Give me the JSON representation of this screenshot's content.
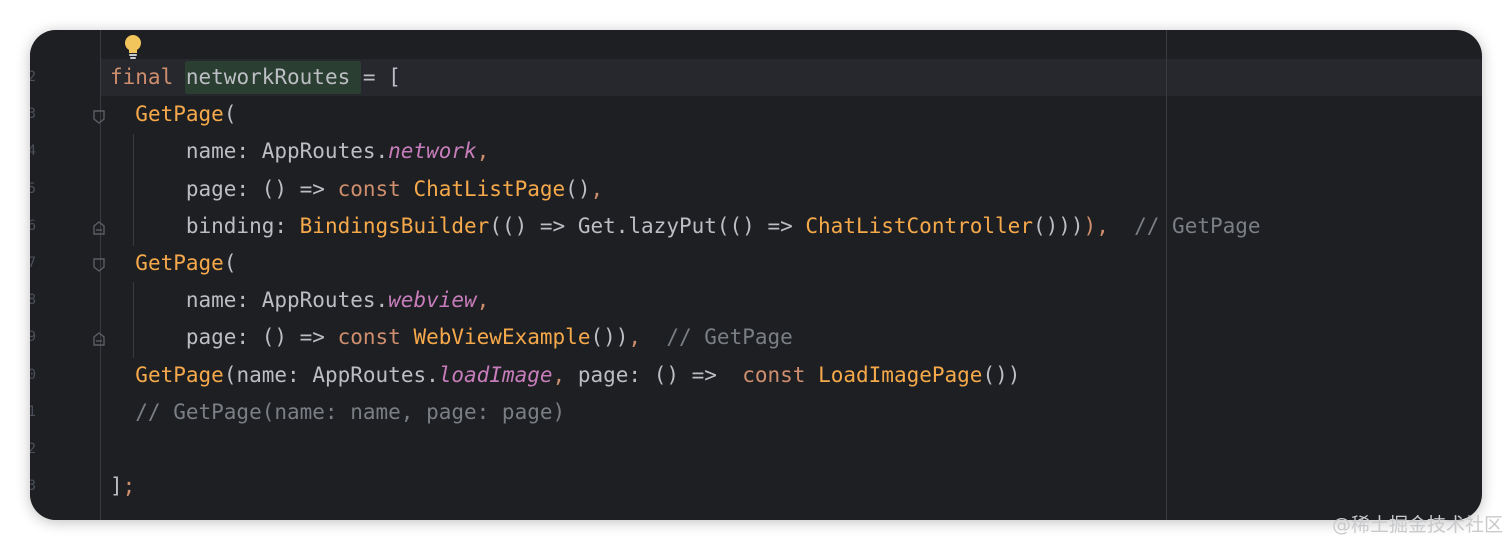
{
  "editor": {
    "line_numbers": [
      "2",
      "3",
      "4",
      "5",
      "6",
      "7",
      "8",
      "9",
      "0",
      "1",
      "2",
      "3"
    ],
    "colors": {
      "background": "#1e1f22",
      "keyword": "#cf8e6d",
      "function": "#f5a94b",
      "field": "#c77dbb",
      "comment": "#7a7e85",
      "plain": "#bcbec4"
    },
    "lines": [
      [
        {
          "t": "final",
          "c": "kw"
        },
        {
          "t": " ",
          "c": "pl"
        },
        {
          "t": "networkRoutes",
          "c": "pl"
        },
        {
          "t": " = [",
          "c": "pl"
        }
      ],
      [
        {
          "t": "  ",
          "c": "pl"
        },
        {
          "t": "GetPage",
          "c": "fn"
        },
        {
          "t": "(",
          "c": "pl"
        }
      ],
      [
        {
          "t": "      name: AppRoutes.",
          "c": "pl"
        },
        {
          "t": "network",
          "c": "fld"
        },
        {
          "t": ",",
          "c": "kw"
        }
      ],
      [
        {
          "t": "      page: () => ",
          "c": "pl"
        },
        {
          "t": "const",
          "c": "kw"
        },
        {
          "t": " ",
          "c": "pl"
        },
        {
          "t": "ChatListPage",
          "c": "fn"
        },
        {
          "t": "()",
          "c": "pl"
        },
        {
          "t": ",",
          "c": "kw"
        }
      ],
      [
        {
          "t": "      binding: ",
          "c": "pl"
        },
        {
          "t": "BindingsBuilder",
          "c": "fn"
        },
        {
          "t": "(() => Get.lazyPut(() => ",
          "c": "pl"
        },
        {
          "t": "ChatListController",
          "c": "fn"
        },
        {
          "t": "()))",
          "c": "pl"
        },
        {
          "t": "),",
          "c": "kw"
        },
        {
          "t": "  // GetPage",
          "c": "cm"
        }
      ],
      [
        {
          "t": "  ",
          "c": "pl"
        },
        {
          "t": "GetPage",
          "c": "fn"
        },
        {
          "t": "(",
          "c": "pl"
        }
      ],
      [
        {
          "t": "      name: AppRoutes.",
          "c": "pl"
        },
        {
          "t": "webview",
          "c": "fld"
        },
        {
          "t": ",",
          "c": "kw"
        }
      ],
      [
        {
          "t": "      page: () => ",
          "c": "pl"
        },
        {
          "t": "const",
          "c": "kw"
        },
        {
          "t": " ",
          "c": "pl"
        },
        {
          "t": "WebViewExample",
          "c": "fn"
        },
        {
          "t": "())",
          "c": "pl"
        },
        {
          "t": ",",
          "c": "kw"
        },
        {
          "t": "  // GetPage",
          "c": "cm"
        }
      ],
      [
        {
          "t": "  ",
          "c": "pl"
        },
        {
          "t": "GetPage",
          "c": "fn"
        },
        {
          "t": "(name: AppRoutes.",
          "c": "pl"
        },
        {
          "t": "loadImage",
          "c": "fld"
        },
        {
          "t": ",",
          "c": "kw"
        },
        {
          "t": " page: () =>  ",
          "c": "pl"
        },
        {
          "t": "const",
          "c": "kw"
        },
        {
          "t": " ",
          "c": "pl"
        },
        {
          "t": "LoadImagePage",
          "c": "fn"
        },
        {
          "t": "())",
          "c": "pl"
        }
      ],
      [
        {
          "t": "  // GetPage(name: name, page: page)",
          "c": "cm"
        }
      ],
      [],
      [
        {
          "t": "]",
          "c": "pl"
        },
        {
          "t": ";",
          "c": "kw"
        }
      ]
    ]
  },
  "watermark": "@稀土掘金技术社区"
}
